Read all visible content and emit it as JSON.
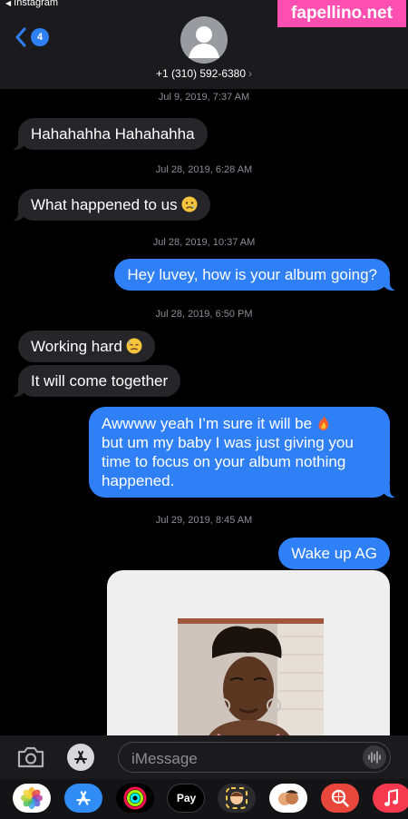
{
  "status_bar": {
    "back_app": "Instagram"
  },
  "watermark": "fapellino.net",
  "header": {
    "unread_badge": "4",
    "contact": "+1 (310) 592-6380",
    "contact_chevron": "›"
  },
  "messages": [
    {
      "type": "timestamp",
      "text": "Jul 9, 2019, 7:37 AM"
    },
    {
      "type": "incoming",
      "text": "Hahahahha Hahahahha"
    },
    {
      "type": "timestamp",
      "text": "Jul 28, 2019, 6:28 AM"
    },
    {
      "type": "incoming",
      "text": "What happened to us",
      "emoji": "sad-face-emoji"
    },
    {
      "type": "timestamp",
      "text": "Jul 28, 2019, 10:37 AM"
    },
    {
      "type": "outgoing",
      "text": "Hey luvey, how is your album going?"
    },
    {
      "type": "timestamp",
      "text": "Jul 28, 2019, 6:50 PM"
    },
    {
      "type": "incoming",
      "text": "Working hard",
      "emoji": "sweat-face-emoji"
    },
    {
      "type": "incoming",
      "text": "It will come together"
    },
    {
      "type": "outgoing",
      "text": "Awwww yeah I’m sure it will be",
      "emoji": "fire-emoji",
      "lines": [
        "but um my baby I was just giving you",
        "time to focus on your album nothing",
        "happened."
      ]
    },
    {
      "type": "timestamp",
      "text": "Jul 29, 2019, 8:45 AM"
    },
    {
      "type": "outgoing",
      "text": "Wake up AG"
    },
    {
      "type": "image",
      "alt": "photo-attachment"
    }
  ],
  "input": {
    "placeholder": "iMessage"
  },
  "drawer": {
    "apps": [
      "photos-icon",
      "app-store-icon",
      "activity-icon",
      "apple-pay-icon",
      "memoji-icon",
      "memoji-stickers-icon",
      "web-search-icon",
      "music-icon"
    ],
    "apple_pay_label": "Pay"
  },
  "colors": {
    "incoming_bubble": "#26252a",
    "outgoing_bubble": "#2f7ff6",
    "background": "#000000",
    "watermark_bg": "#ff4fb0"
  }
}
